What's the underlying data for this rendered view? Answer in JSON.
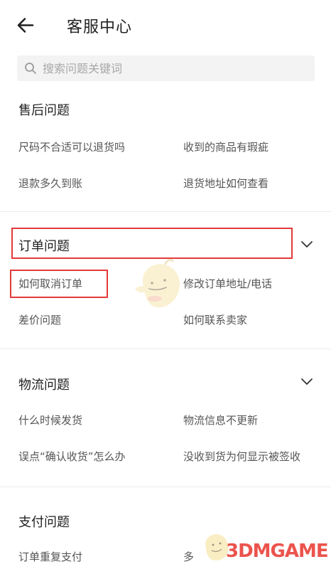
{
  "header": {
    "back_icon": "arrow-left-icon",
    "title": "客服中心"
  },
  "search": {
    "icon": "search-icon",
    "placeholder": "搜索问题关键词",
    "value": ""
  },
  "sections": [
    {
      "title": "售后问题",
      "collapsible": false,
      "items": [
        "尺码不合适可以退货吗",
        "收到的商品有瑕疵",
        "退款多久到账",
        "退货地址如何查看"
      ]
    },
    {
      "title": "订单问题",
      "collapsible": true,
      "chevron_icon": "chevron-down-icon",
      "items": [
        "如何取消订单",
        "修改订单地址/电话",
        "差价问题",
        "如何联系卖家"
      ]
    },
    {
      "title": "物流问题",
      "collapsible": true,
      "chevron_icon": "chevron-down-icon",
      "items": [
        "什么时候发货",
        "物流信息不更新",
        "误点“确认收货”怎么办",
        "没收到货为何显示被签收"
      ]
    },
    {
      "title": "支付问题",
      "collapsible": false,
      "items": [
        "订单重复支付",
        "多"
      ]
    }
  ],
  "highlight_color": "#e23a3a",
  "watermark": {
    "text": "3DMGAME",
    "color": "#e8372e"
  }
}
